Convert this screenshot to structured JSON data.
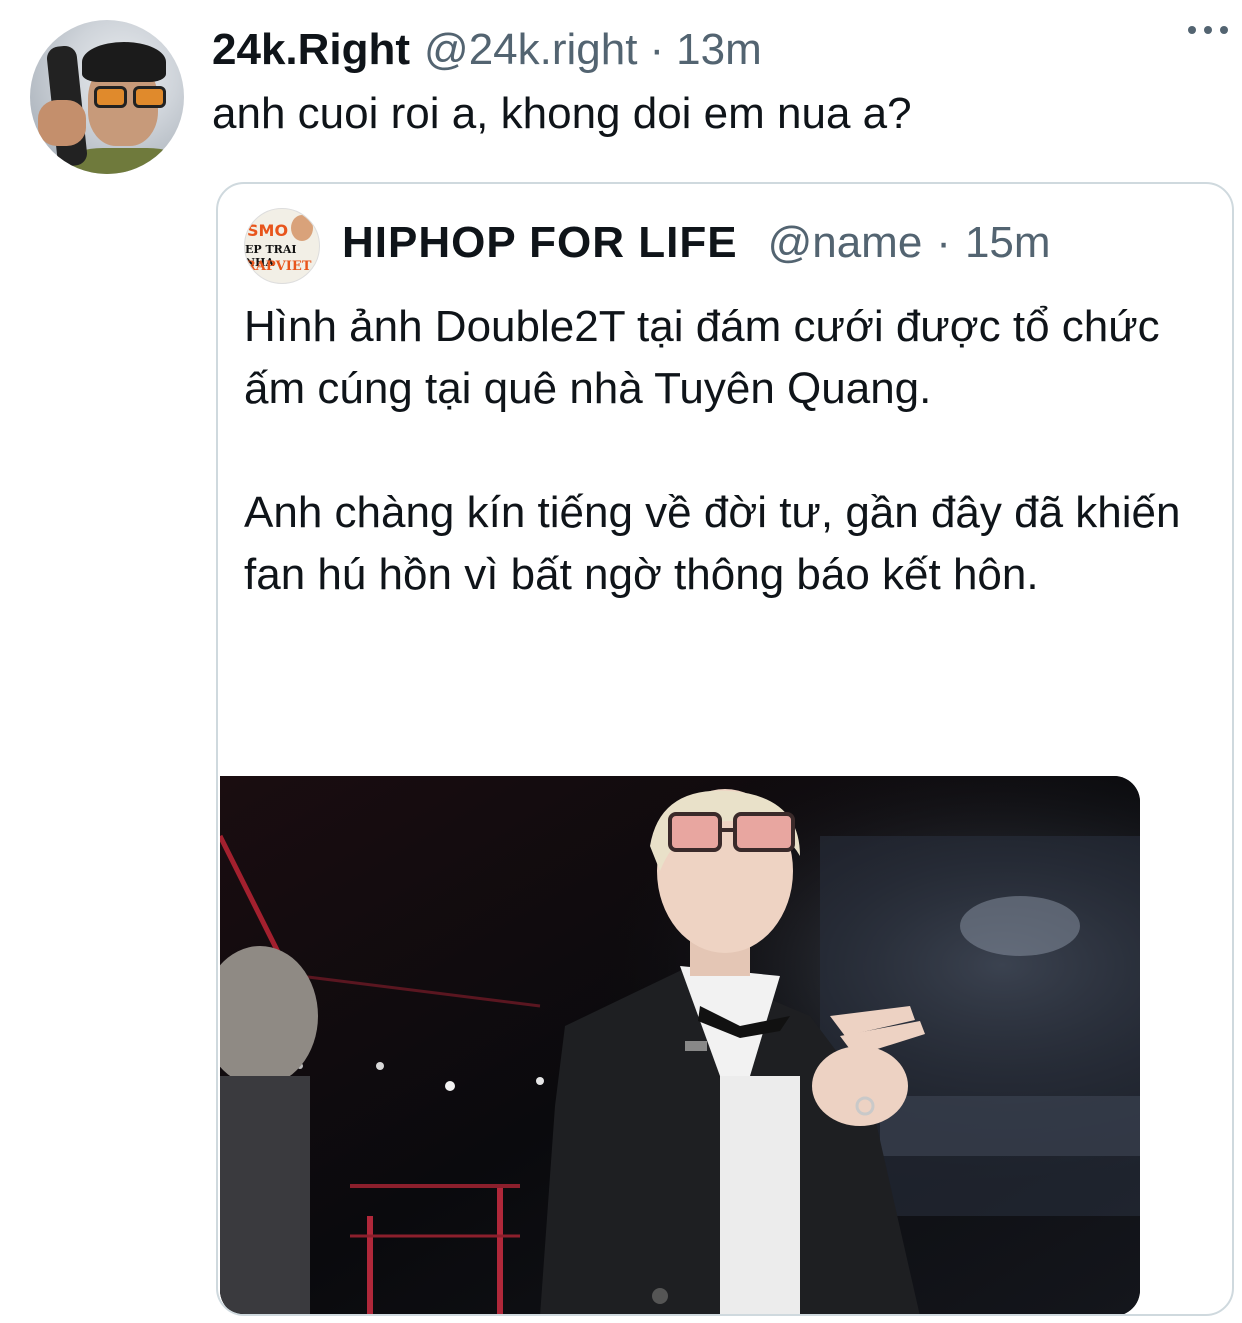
{
  "tweet": {
    "display_name": "24k.Right",
    "handle": "@24k.right",
    "separator": "·",
    "time": "13m",
    "text": "anh cuoi roi a, khong doi em nua a?",
    "more_icon": "more-horizontal-icon"
  },
  "quoted_tweet": {
    "avatar_text": {
      "line1": "SMO",
      "line2": "EP TRAI NHA",
      "line3": "RAPVIET"
    },
    "display_name": "HIPHOP FOR LIFE",
    "handle": "@name",
    "separator": "·",
    "time": "15m",
    "text": "Hình ảnh Double2T tại đám cưới được tổ chức ấm cúng tại quê nhà Tuyên Quang.\n\nAnh chàng kín tiếng về đời tư, gần đây đã khiến fan hú hồn vì bất ngờ thông báo kết hôn."
  },
  "colors": {
    "text_primary": "#0f1419",
    "text_secondary": "#536471",
    "border": "#cfd9de",
    "avatar_accent": "#e8551c"
  }
}
